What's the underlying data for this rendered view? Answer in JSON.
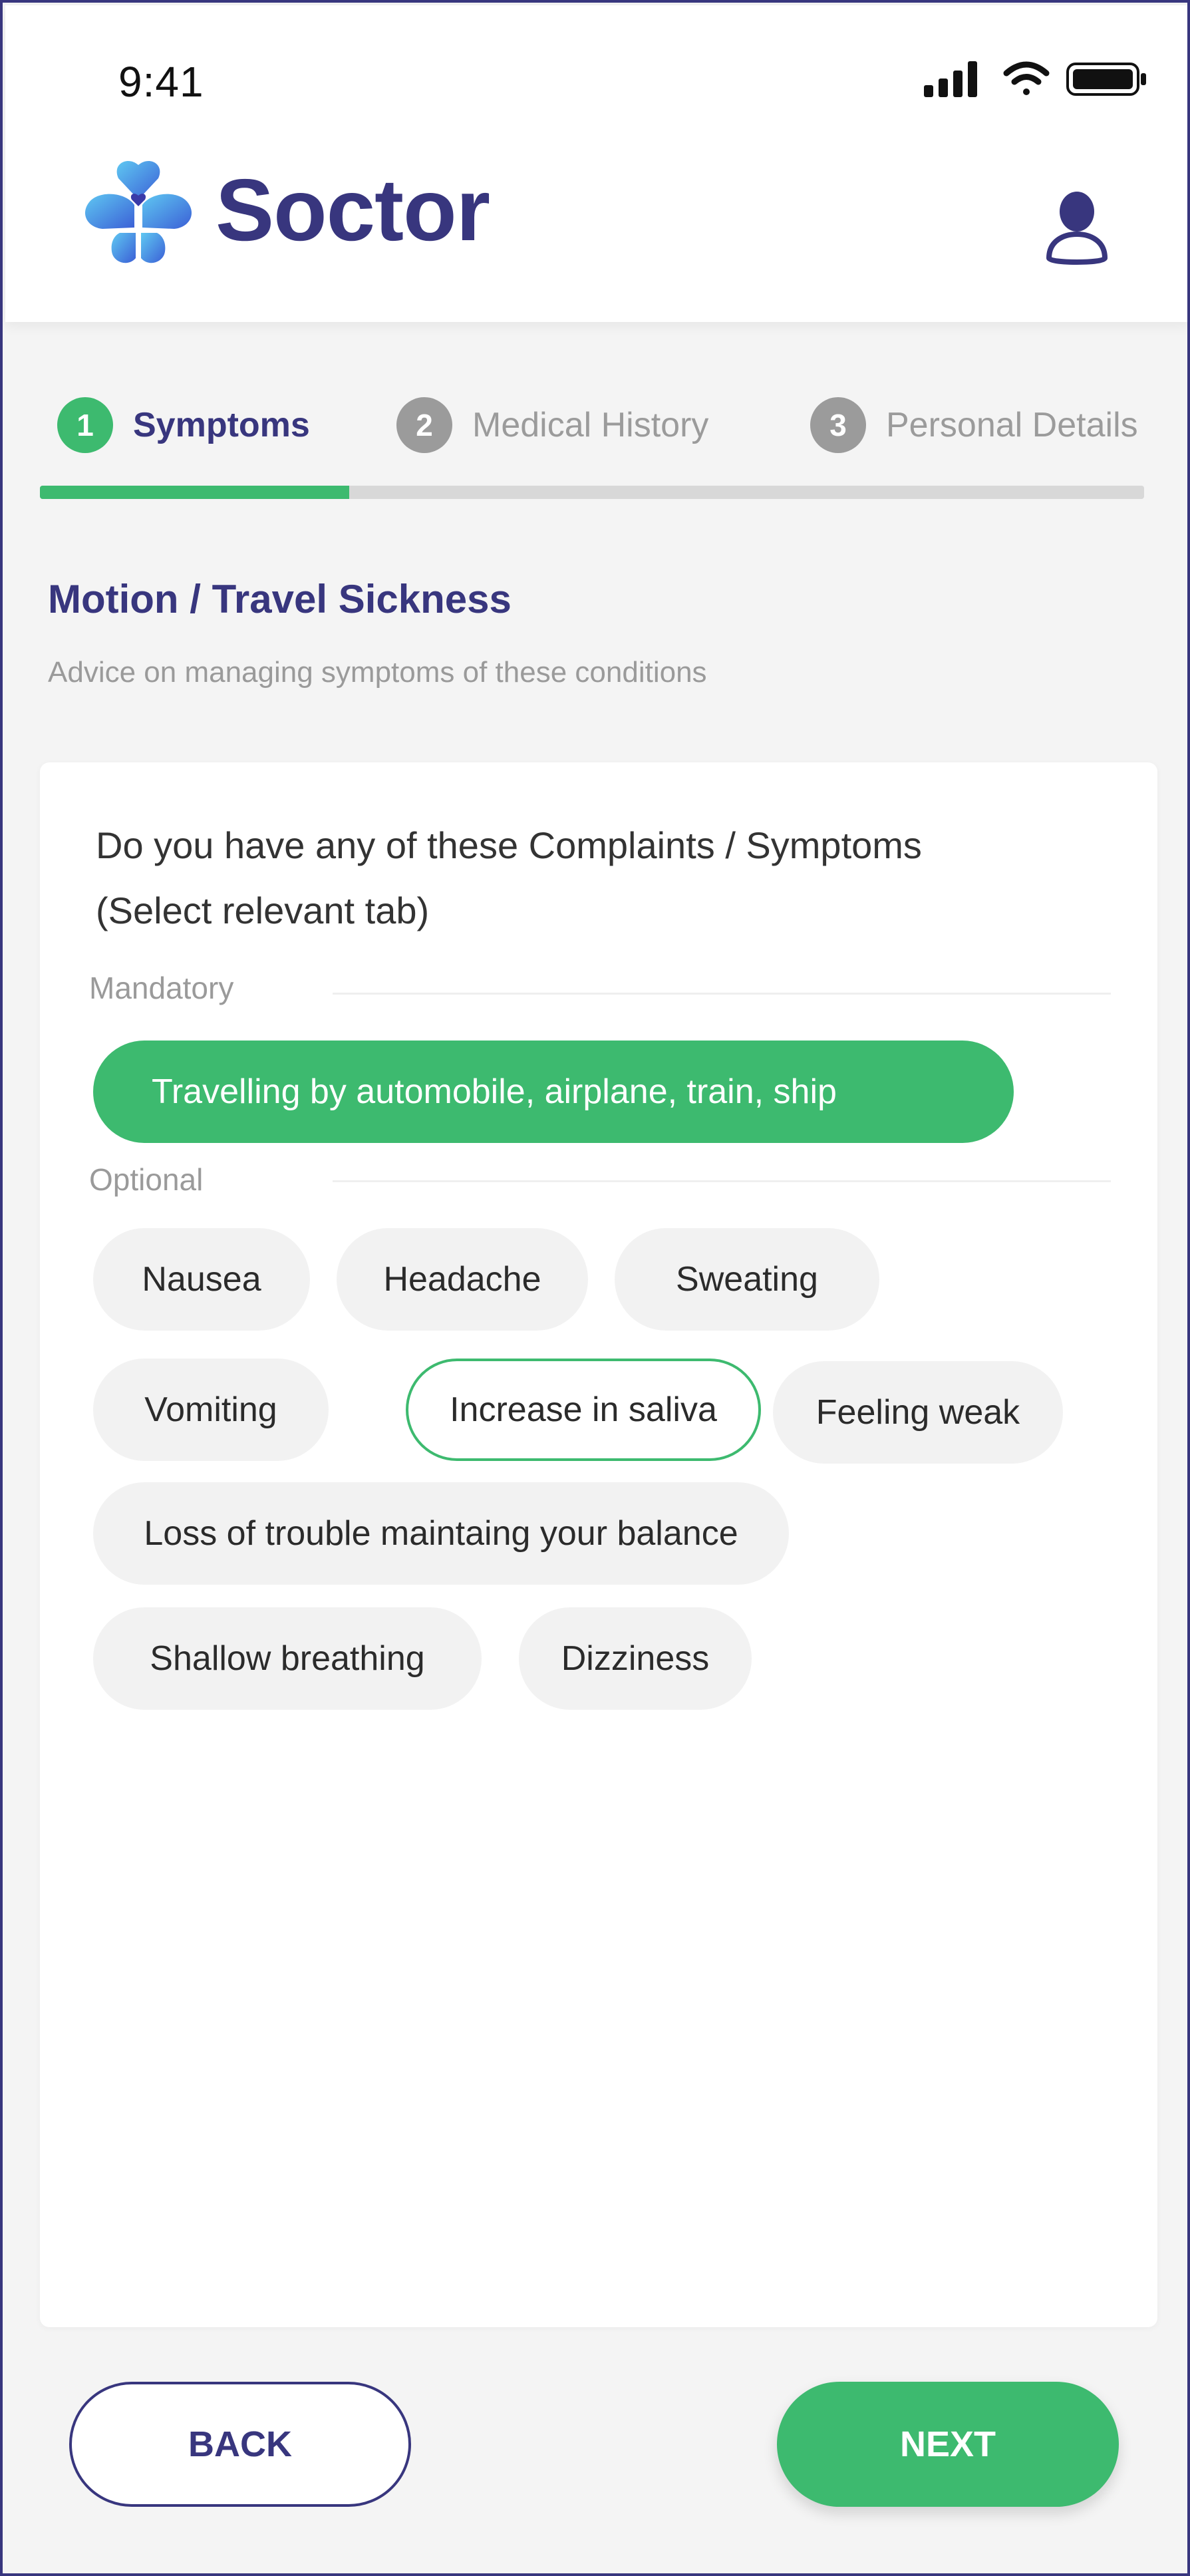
{
  "status_bar": {
    "time": "9:41",
    "icons": [
      "signal-icon",
      "wifi-icon",
      "battery-icon"
    ]
  },
  "header": {
    "brand": "Soctor",
    "logo_icon": "hearts-clover-logo",
    "profile_icon": "user-icon"
  },
  "stepper": {
    "steps": [
      {
        "number": "1",
        "label": "Symptoms",
        "state": "active"
      },
      {
        "number": "2",
        "label": "Medical History",
        "state": "inactive"
      },
      {
        "number": "3",
        "label": "Personal Details",
        "state": "inactive"
      }
    ],
    "progress": 0.28
  },
  "page": {
    "title": "Motion / Travel Sickness",
    "subtitle": "Advice on managing symptoms of these conditions"
  },
  "card": {
    "question_line1": "Do you have any of these Complaints / Symptoms",
    "question_line2": "(Select relevant tab)",
    "mandatory_label": "Mandatory",
    "mandatory_chip": "Travelling by automobile, airplane, train, ship",
    "optional_label": "Optional",
    "optional_chips": [
      "Nausea",
      "Headache",
      "Sweating",
      "Vomiting",
      "Increase in saliva",
      "Feeling weak",
      "Loss of trouble maintaing your balance",
      "Shallow breathing",
      "Dizziness"
    ],
    "selected_chip": "Increase in saliva"
  },
  "footer": {
    "back_label": "BACK",
    "next_label": "NEXT"
  },
  "colors": {
    "primary": "#38367e",
    "accent": "#3dba6f",
    "inactive": "#9b9b9b",
    "chip_bg": "#f2f2f2"
  }
}
